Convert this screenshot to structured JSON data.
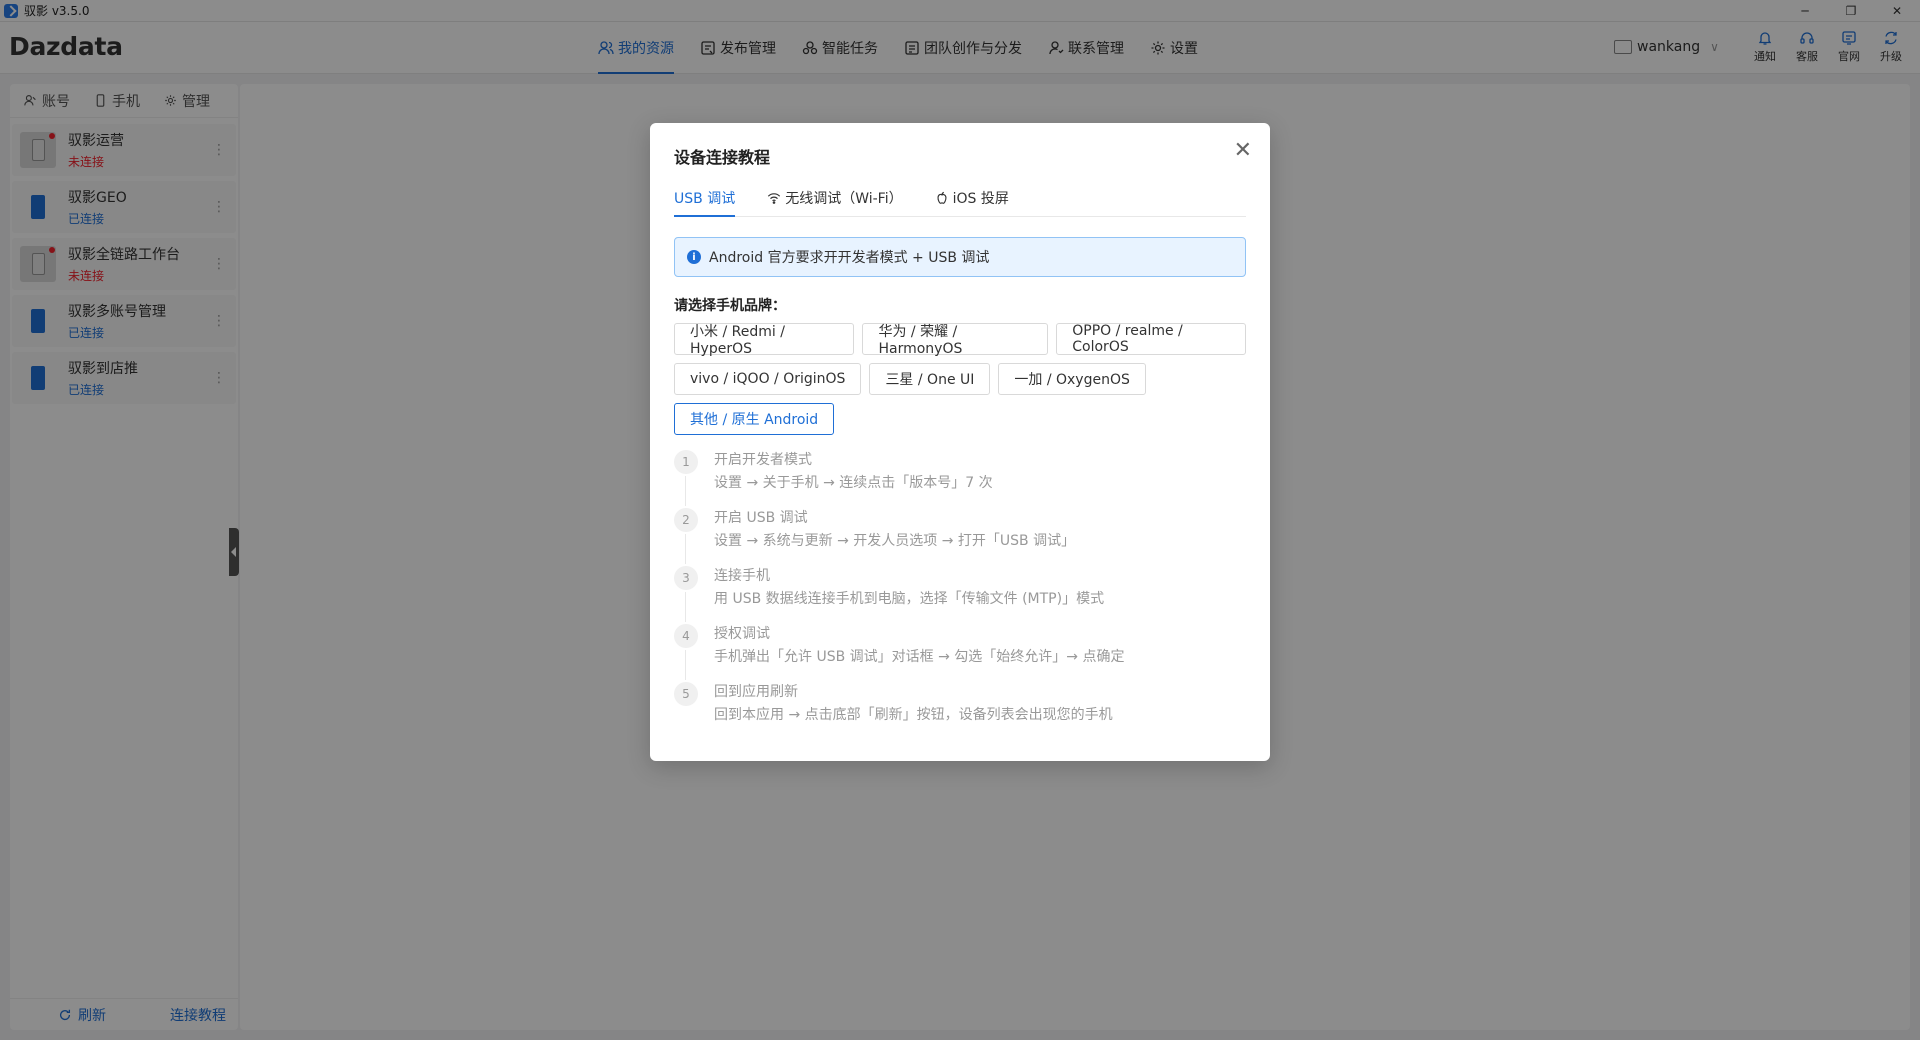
{
  "window": {
    "title": "驭影 v3.5.0",
    "controls": {
      "minimize": "─",
      "restore": "❐",
      "close": "✕"
    }
  },
  "header": {
    "logo": "Dazdata",
    "nav": [
      {
        "label": "我的资源",
        "icon": "users-icon",
        "active": true
      },
      {
        "label": "发布管理",
        "icon": "publish-icon",
        "active": false
      },
      {
        "label": "智能任务",
        "icon": "task-icon",
        "active": false
      },
      {
        "label": "团队创作与分发",
        "icon": "team-icon",
        "active": false
      },
      {
        "label": "联系管理",
        "icon": "contact-icon",
        "active": false
      },
      {
        "label": "设置",
        "icon": "gear-icon",
        "active": false
      }
    ],
    "user": {
      "name": "wankang"
    },
    "icons": [
      {
        "label": "通知",
        "icon": "bell-icon"
      },
      {
        "label": "客服",
        "icon": "headset-icon"
      },
      {
        "label": "官网",
        "icon": "website-icon"
      },
      {
        "label": "升级",
        "icon": "refresh-icon"
      }
    ]
  },
  "sidebar": {
    "tabs": [
      {
        "label": "账号",
        "icon": "account-icon"
      },
      {
        "label": "手机",
        "icon": "phone-icon"
      },
      {
        "label": "管理",
        "icon": "gear-icon"
      }
    ],
    "devices": [
      {
        "name": "驭影运营",
        "status": "未连接",
        "connected": false
      },
      {
        "name": "驭影GEO",
        "status": "已连接",
        "connected": true
      },
      {
        "name": "驭影全链路工作台",
        "status": "未连接",
        "connected": false
      },
      {
        "name": "驭影多账号管理",
        "status": "已连接",
        "connected": true
      },
      {
        "name": "驭影到店推",
        "status": "已连接",
        "connected": true
      }
    ],
    "more": "⋮",
    "footer": {
      "refresh": "刷新",
      "tutorial": "连接教程"
    }
  },
  "modal": {
    "title": "设备连接教程",
    "close": "✕",
    "tabs": [
      {
        "label": "USB 调试",
        "active": true
      },
      {
        "label": "无线调试（Wi-Fi）",
        "icon": "wifi-icon",
        "active": false
      },
      {
        "label": "iOS 投屏",
        "icon": "apple-icon",
        "active": false
      }
    ],
    "alert": {
      "icon": "i",
      "text": "Android 官方要求开开发者模式 + USB 调试"
    },
    "brand_label": "请选择手机品牌：",
    "brands": [
      "小米 / Redmi / HyperOS",
      "华为 / 荣耀 / HarmonyOS",
      "OPPO / realme / ColorOS",
      "vivo / iQOO / OriginOS",
      "三星 / One UI",
      "一加 / OxygenOS",
      "其他 / 原生 Android"
    ],
    "selected_brand": "其他 / 原生 Android",
    "steps": [
      {
        "num": "1",
        "title": "开启开发者模式",
        "desc": "设置 → 关于手机 → 连续点击「版本号」7 次"
      },
      {
        "num": "2",
        "title": "开启 USB 调试",
        "desc": "设置 → 系统与更新 → 开发人员选项 → 打开「USB 调试」"
      },
      {
        "num": "3",
        "title": "连接手机",
        "desc": "用 USB 数据线连接手机到电脑，选择「传输文件 (MTP)」模式"
      },
      {
        "num": "4",
        "title": "授权调试",
        "desc": "手机弹出「允许 USB 调试」对话框 → 勾选「始终允许」→ 点确定"
      },
      {
        "num": "5",
        "title": "回到应用刷新",
        "desc": "回到本应用 → 点击底部「刷新」按钮，设备列表会出现您的手机"
      }
    ]
  }
}
